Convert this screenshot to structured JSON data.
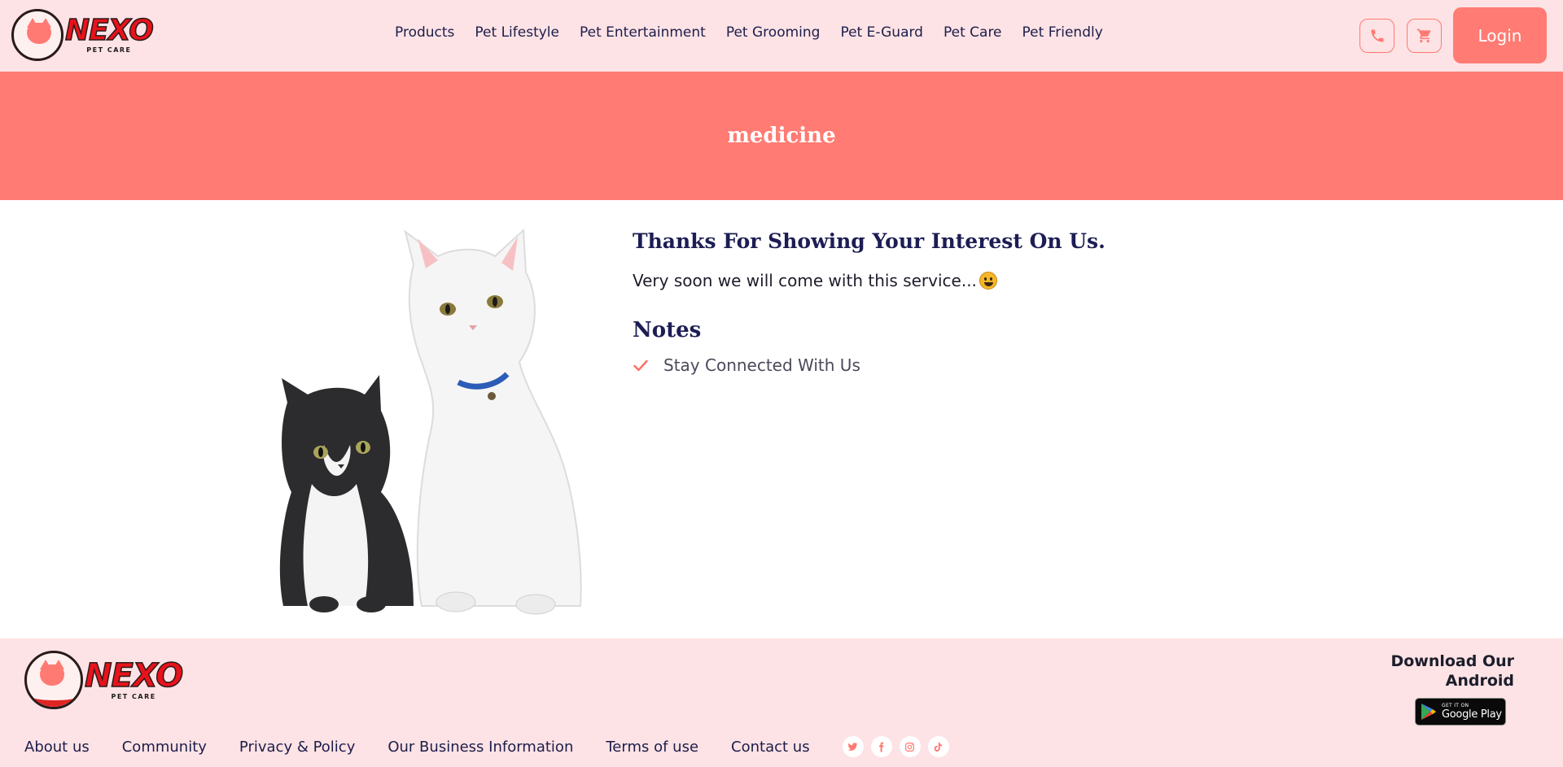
{
  "brand": {
    "name": "NEXO",
    "tagline": "PET CARE",
    "accent": "#ff7b73",
    "header_bg": "#fde3e5",
    "text_dark": "#1d1d4b"
  },
  "nav": {
    "items": [
      {
        "label": "Products"
      },
      {
        "label": "Pet Lifestyle"
      },
      {
        "label": "Pet Entertainment"
      },
      {
        "label": "Pet Grooming"
      },
      {
        "label": "Pet E-Guard"
      },
      {
        "label": "Pet Care"
      },
      {
        "label": "Pet Friendly"
      }
    ],
    "phone_icon": "phone-icon",
    "cart_icon": "cart-icon",
    "login_label": "Login"
  },
  "banner": {
    "title": "medicine"
  },
  "main": {
    "heading": "Thanks For Showing Your Interest On Us.",
    "message": "Very soon we will come with this service...",
    "emoji_icon": "grinning-face-icon",
    "notes_title": "Notes",
    "notes": [
      {
        "text": "Stay Connected With Us",
        "icon": "check-icon"
      }
    ],
    "image_icon": "two-cats-image"
  },
  "footer": {
    "links": [
      {
        "label": "About us"
      },
      {
        "label": "Community"
      },
      {
        "label": "Privacy & Policy"
      },
      {
        "label": "Our Business Information"
      },
      {
        "label": "Terms of use"
      },
      {
        "label": "Contact us"
      }
    ],
    "social": [
      "twitter-icon",
      "facebook-icon",
      "instagram-icon",
      "tiktok-icon"
    ],
    "download_line1": "Download Our",
    "download_line2": "Android",
    "gplay_small": "GET IT ON",
    "gplay_big": "Google Play"
  }
}
